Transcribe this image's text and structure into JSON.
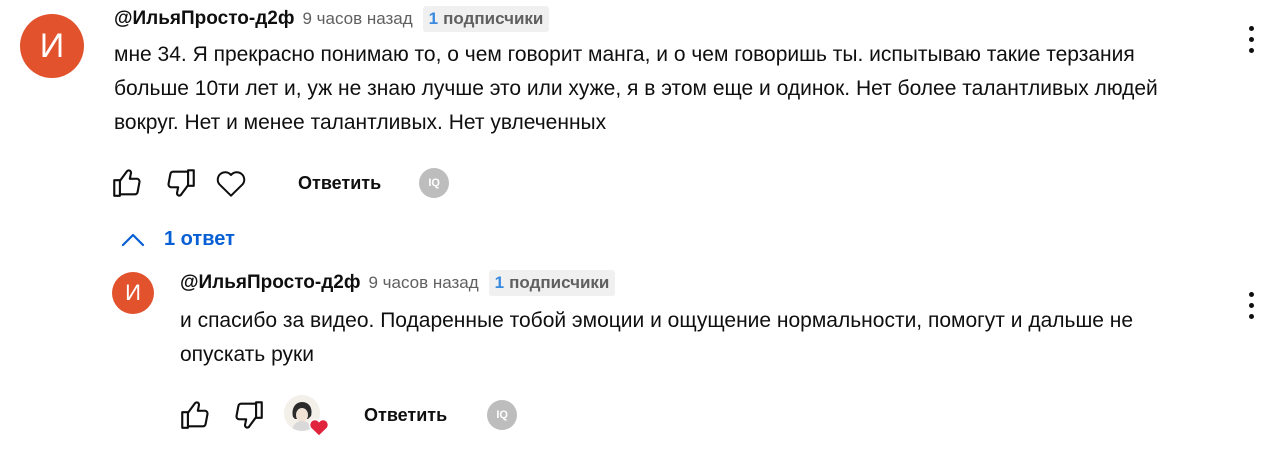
{
  "comment": {
    "avatar_letter": "И",
    "author": "@ИльяПросто-д2ф",
    "time": "9 часов назад",
    "badge_count": "1",
    "badge_label": "подписчики",
    "text": "мне 34. Я прекрасно понимаю то, о чем говорит манга, и о чем говоришь ты. испытываю такие терзания больше 10ти лет и, уж не знаю лучше это или хуже, я в этом еще и одинок. Нет более талантливых людей вокруг. Нет и менее талантливых. Нет увлеченных",
    "reply_label": "Ответить",
    "tl_badge": "IQ"
  },
  "replies_toggle": {
    "label": "1 ответ",
    "icon": "chevron-up-icon"
  },
  "reply": {
    "avatar_letter": "И",
    "author": "@ИльяПросто-д2ф",
    "time": "9 часов назад",
    "badge_count": "1",
    "badge_label": "подписчики",
    "text": "и спасибо за видео. Подаренные тобой эмоции и ощущение нормальности, помогут и дальше не опускать руки",
    "reply_label": "Ответить",
    "tl_badge": "IQ"
  },
  "colors": {
    "avatar": "#e2522d",
    "link": "#065fd4",
    "badge_num": "#3a8be0",
    "heart": "#e0243c"
  }
}
